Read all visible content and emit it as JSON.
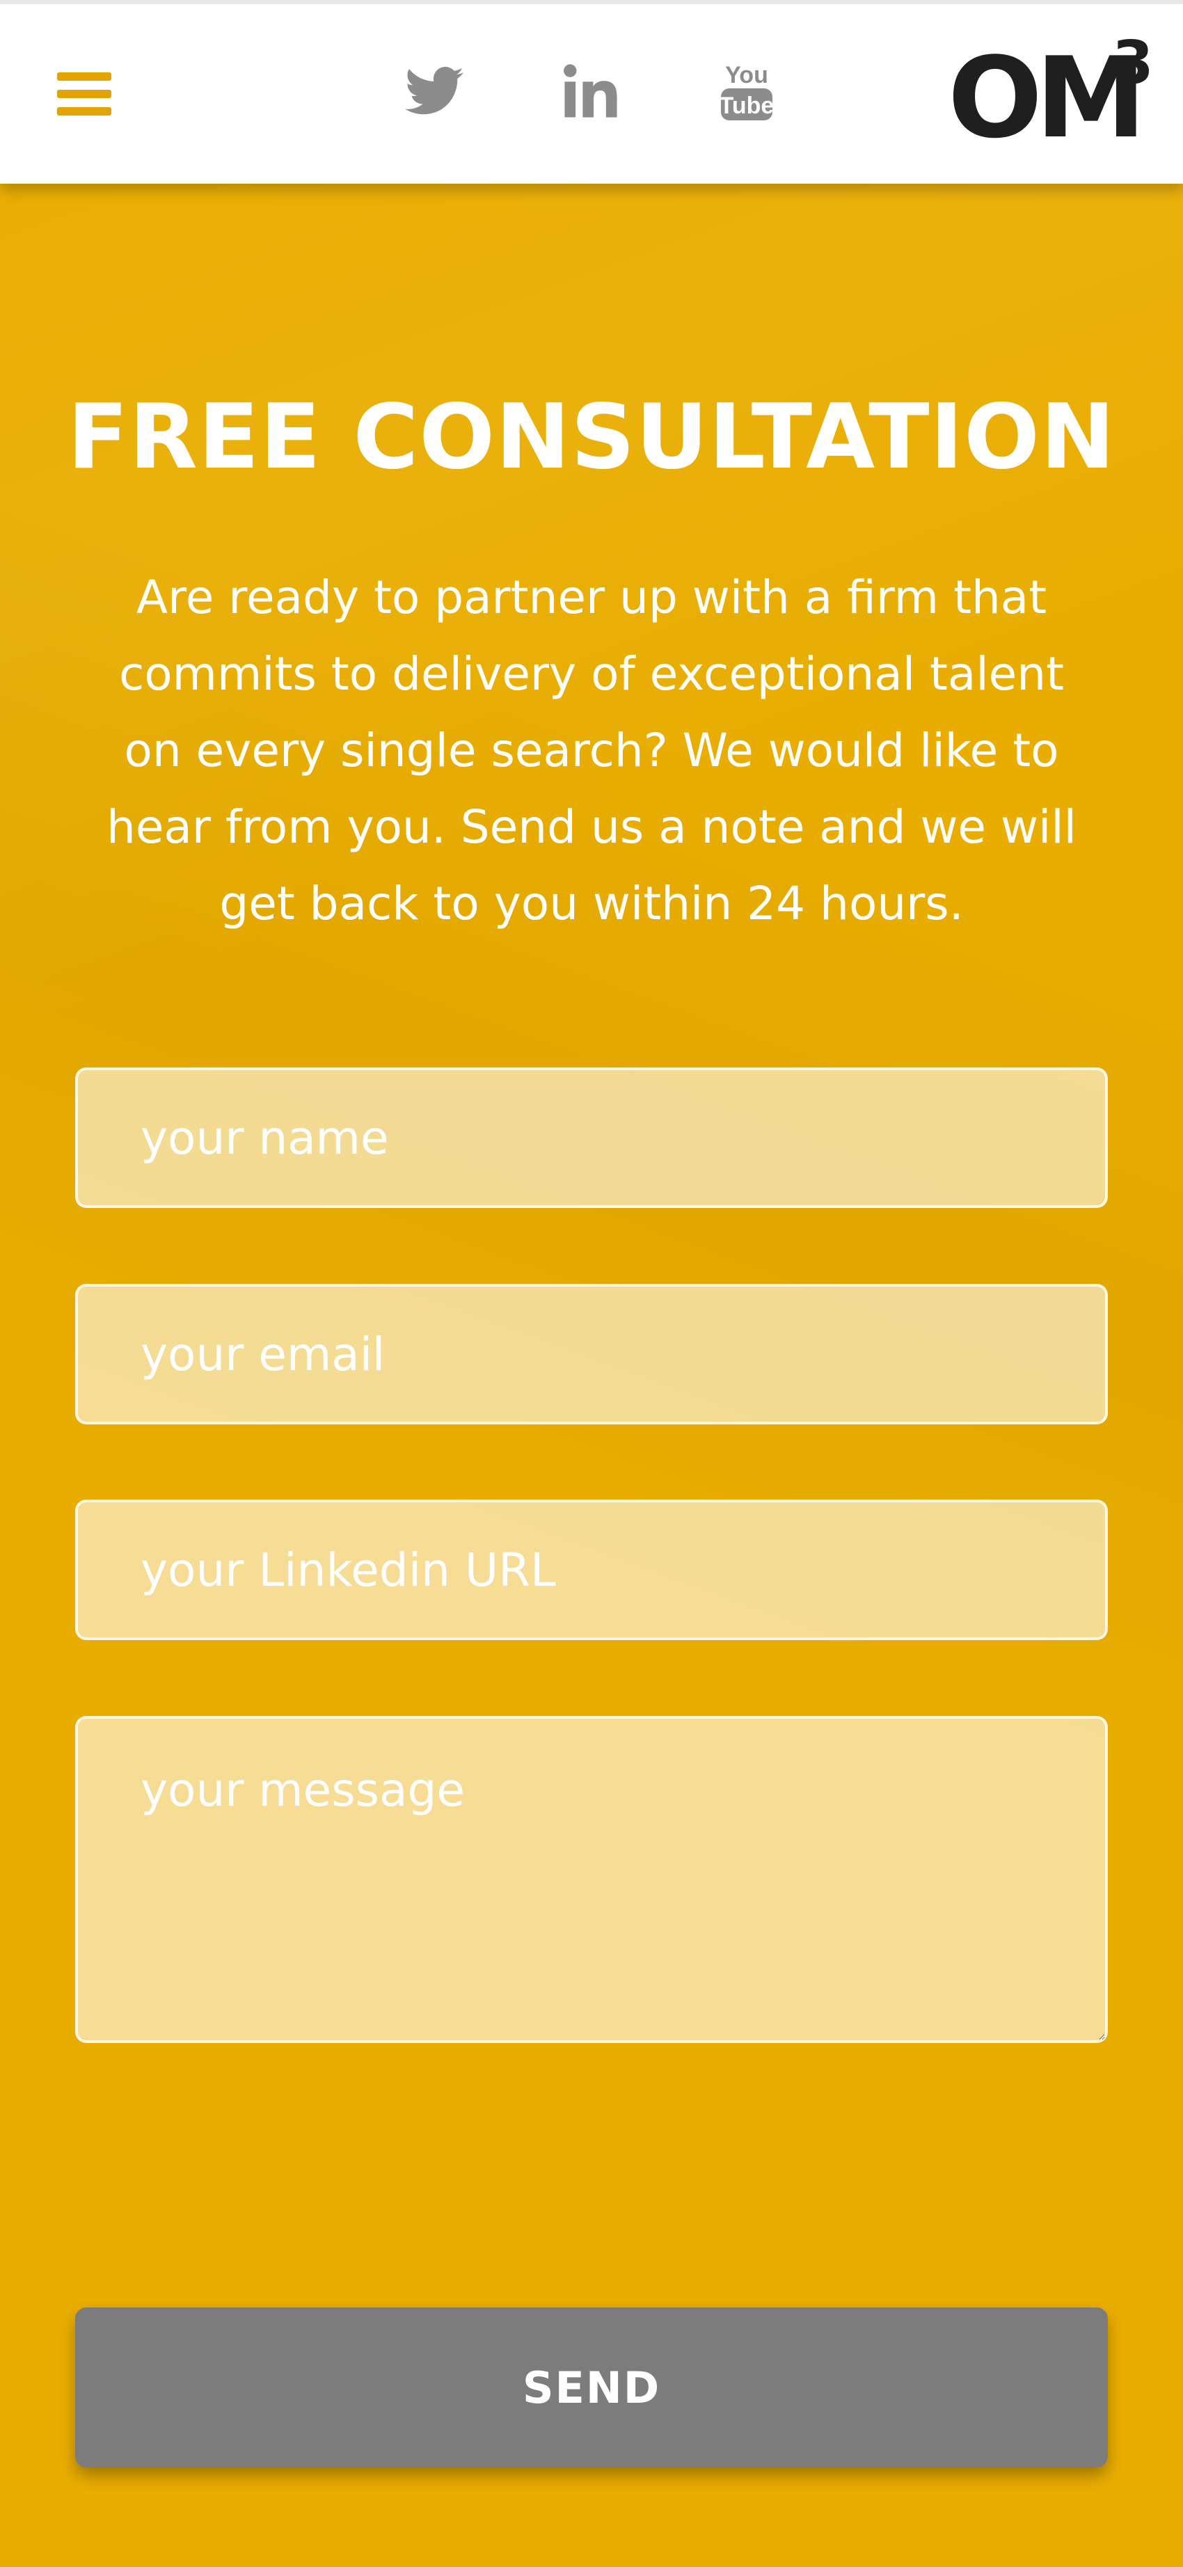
{
  "header": {
    "menu_icon": "hamburger-menu-icon",
    "social": [
      {
        "name": "twitter",
        "icon": "twitter-bird-icon"
      },
      {
        "name": "linkedin",
        "icon": "linkedin-in-icon"
      },
      {
        "name": "youtube",
        "icon": "youtube-icon",
        "text_top": "You",
        "text_bottom": "Tube"
      }
    ],
    "logo": {
      "text": "OM",
      "superscript": "3"
    }
  },
  "main": {
    "title": "FREE CONSULTATION",
    "intro": "Are ready to partner up with a firm that commits to delivery of exceptional talent on every single search?  We would like to hear from you.  Send us a note and we will get back to you within 24 hours."
  },
  "form": {
    "name_placeholder": "your name",
    "email_placeholder": "your email",
    "linkedin_placeholder": "your Linkedin URL",
    "message_placeholder": "your message",
    "send_label": "SEND"
  },
  "colors": {
    "accent": "#e9ad00",
    "menu_icon": "#e3a300",
    "button": "#7c7c7c",
    "social_icon": "#8c8c8c",
    "logo": "#1f1f1f"
  }
}
